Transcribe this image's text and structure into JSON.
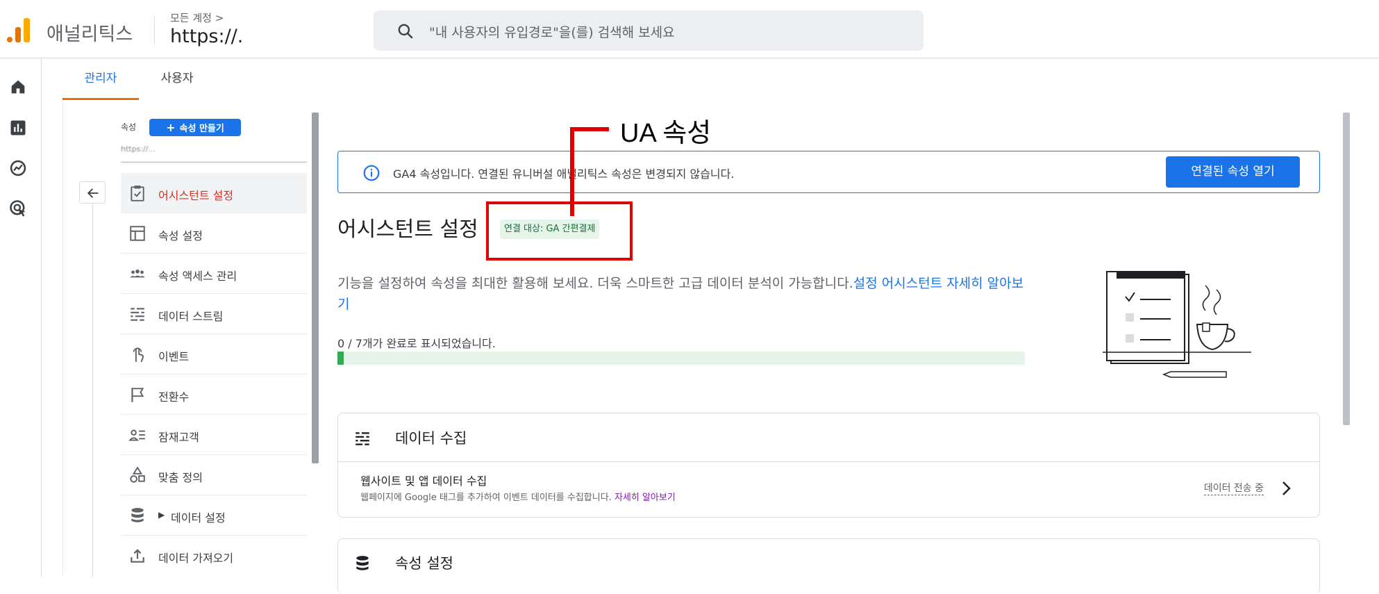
{
  "header": {
    "product_name": "애널리틱스",
    "account_crumb": "모든 계정 >",
    "account_name": "https://.",
    "search_placeholder": "\"내 사용자의 유입경로\"을(를) 검색해 보세요"
  },
  "rail": {
    "icons": [
      "home-icon",
      "reports-icon",
      "explore-icon",
      "advertising-icon"
    ]
  },
  "tabs": [
    {
      "label": "관리자",
      "active": true
    },
    {
      "label": "사용자",
      "active": false
    }
  ],
  "property": {
    "label": "속성",
    "create_button": "속성 만들기",
    "selected": "https://..."
  },
  "menu": [
    {
      "label": "어시스턴트 설정",
      "icon": "clipboard-check-icon",
      "active": true
    },
    {
      "label": "속성 설정",
      "icon": "layout-icon",
      "active": false
    },
    {
      "label": "속성 액세스 관리",
      "icon": "people-icon",
      "active": false
    },
    {
      "label": "데이터 스트림",
      "icon": "streams-icon",
      "active": false
    },
    {
      "label": "이벤트",
      "icon": "touch-icon",
      "active": false
    },
    {
      "label": "전환수",
      "icon": "flag-icon",
      "active": false
    },
    {
      "label": "잠재고객",
      "icon": "audience-icon",
      "active": false
    },
    {
      "label": "맞춤 정의",
      "icon": "shapes-icon",
      "active": false
    },
    {
      "label": "데이터 설정",
      "icon": "database-icon",
      "active": false
    },
    {
      "label": "데이터 가져오기",
      "icon": "upload-icon",
      "active": false
    }
  ],
  "banner": {
    "text": "GA4 속성입니다. 연결된 유니버설 애널리틱스 속성은 변경되지 않습니다.",
    "button": "연결된 속성 열기"
  },
  "main": {
    "title": "어시스턴트 설정",
    "chip": "연결 대상: GA 간편결제",
    "description": "기능을 설정하여 속성을 최대한 활용해 보세요. 더욱 스마트한 고급 데이터 분석이 가능합니다.",
    "description_link": "설정 어시스턴트 자세히 알아보기",
    "progress_label": "0 / 7개가 완료로 표시되었습니다.",
    "progress_fraction": 0.0
  },
  "cards": [
    {
      "title": "데이터 수집",
      "icon": "streams-icon",
      "row_title": "웹사이트 및 앱 데이터 수집",
      "row_sub": "웹페이지에 Google 태그를 추가하여 이벤트 데이터를 수집합니다.",
      "row_link": "자세히 알아보기",
      "row_status": "데이터 전송 중"
    },
    {
      "title": "속성 설정",
      "icon": "database-icon"
    }
  ],
  "annotation": {
    "label": "UA 속성"
  },
  "colors": {
    "accent": "#1a73e8",
    "active_menu_text": "#d93025",
    "tab_underline": "#e8710a",
    "chip_bg": "#e6f4ea",
    "progress": "#34a853",
    "annotation": "#e00000"
  }
}
